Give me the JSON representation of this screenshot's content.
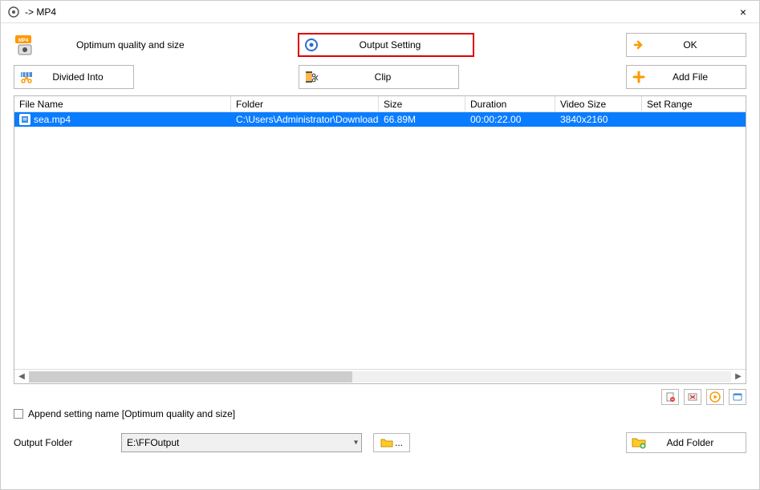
{
  "window": {
    "title": " -> MP4",
    "close_label": "×"
  },
  "toolbar": {
    "quality_label": "Optimum quality and size",
    "output_setting": "Output Setting",
    "ok": "OK",
    "divided_into": "Divided Into",
    "clip": "Clip",
    "add_file": "Add File"
  },
  "table": {
    "headers": {
      "name": "File Name",
      "folder": "Folder",
      "size": "Size",
      "duration": "Duration",
      "video_size": "Video Size",
      "set_range": "Set Range"
    },
    "rows": [
      {
        "name": "sea.mp4",
        "folder": "C:\\Users\\Administrator\\Downloads",
        "size": "66.89M",
        "duration": "00:00:22.00",
        "video_size": "3840x2160",
        "set_range": ""
      }
    ]
  },
  "append": {
    "label": "Append setting name [Optimum quality and size]"
  },
  "output": {
    "label": "Output Folder",
    "value": "E:\\FFOutput",
    "browse_ellipsis": "...",
    "add_folder": "Add Folder"
  }
}
